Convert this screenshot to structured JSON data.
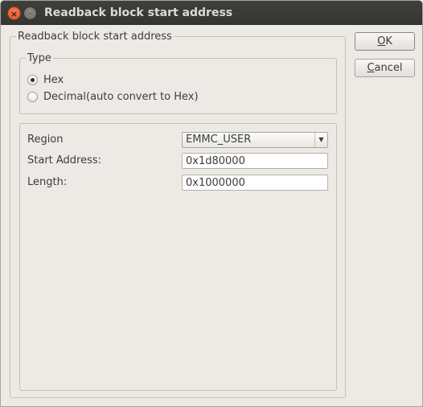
{
  "window": {
    "title": "Readback block start address",
    "close_glyph": "×",
    "minimize_glyph": "–"
  },
  "outer_group": {
    "title": "Readback block start address"
  },
  "type_group": {
    "title": "Type",
    "options": [
      {
        "label": "Hex",
        "checked": true
      },
      {
        "label": "Decimal(auto convert to Hex)",
        "checked": false
      }
    ]
  },
  "fields": {
    "region_label": "Region",
    "region_value": "EMMC_USER",
    "start_address_label": "Start Address:",
    "start_address_value": "0x1d80000",
    "length_label": "Length:",
    "length_value": "0x1000000"
  },
  "buttons": {
    "ok_mnemonic": "O",
    "ok_rest": "K",
    "cancel_mnemonic": "C",
    "cancel_rest": "ancel"
  },
  "icons": {
    "close": "close-icon",
    "minimize": "minimize-icon",
    "dropdown": "chevron-down-icon"
  },
  "colors": {
    "titlebar": "#3a3a37",
    "close_button": "#e95420",
    "window_background": "#edeae6"
  }
}
